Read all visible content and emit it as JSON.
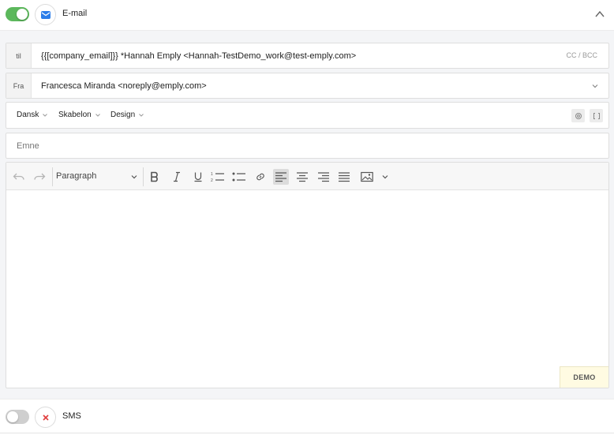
{
  "email_section": {
    "title": "E-mail",
    "enabled": true,
    "icon": "envelope-icon",
    "accent": "#5cb85c",
    "icon_color": "#2b7de9"
  },
  "to_row": {
    "label": "til",
    "value": "{{[company_email]}} *Hannah  Emply <Hannah-TestDemo_work@test-emply.com>",
    "cc_bcc": "CC / BCC"
  },
  "from_row": {
    "label": "Fra",
    "value": "Francesca Miranda <noreply@emply.com>"
  },
  "options": {
    "language": "Dansk",
    "template": "Skabelon",
    "design": "Design"
  },
  "subject": {
    "placeholder": "Emne",
    "value": ""
  },
  "editor": {
    "paragraph_label": "Paragraph",
    "badge": "DEMO",
    "content": ""
  },
  "sms_section": {
    "title": "SMS",
    "enabled": false,
    "icon": "close-icon",
    "icon_color": "#e03c3c"
  }
}
